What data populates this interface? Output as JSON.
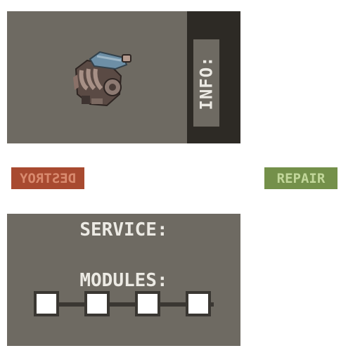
{
  "info": {
    "label": "INFO:",
    "item_icon": "engine-block-icon"
  },
  "actions": {
    "destroy_label": "DESTROY",
    "repair_label": "REPAIR"
  },
  "service": {
    "title": "SERVICE:"
  },
  "modules": {
    "title": "MODULES:",
    "slots": [
      "",
      "",
      "",
      ""
    ]
  },
  "colors": {
    "panel": "#6e6a62",
    "panel_dark": "#2d2a25",
    "destroy": "#a84a30",
    "repair": "#74904a",
    "text": "#eceae4"
  }
}
